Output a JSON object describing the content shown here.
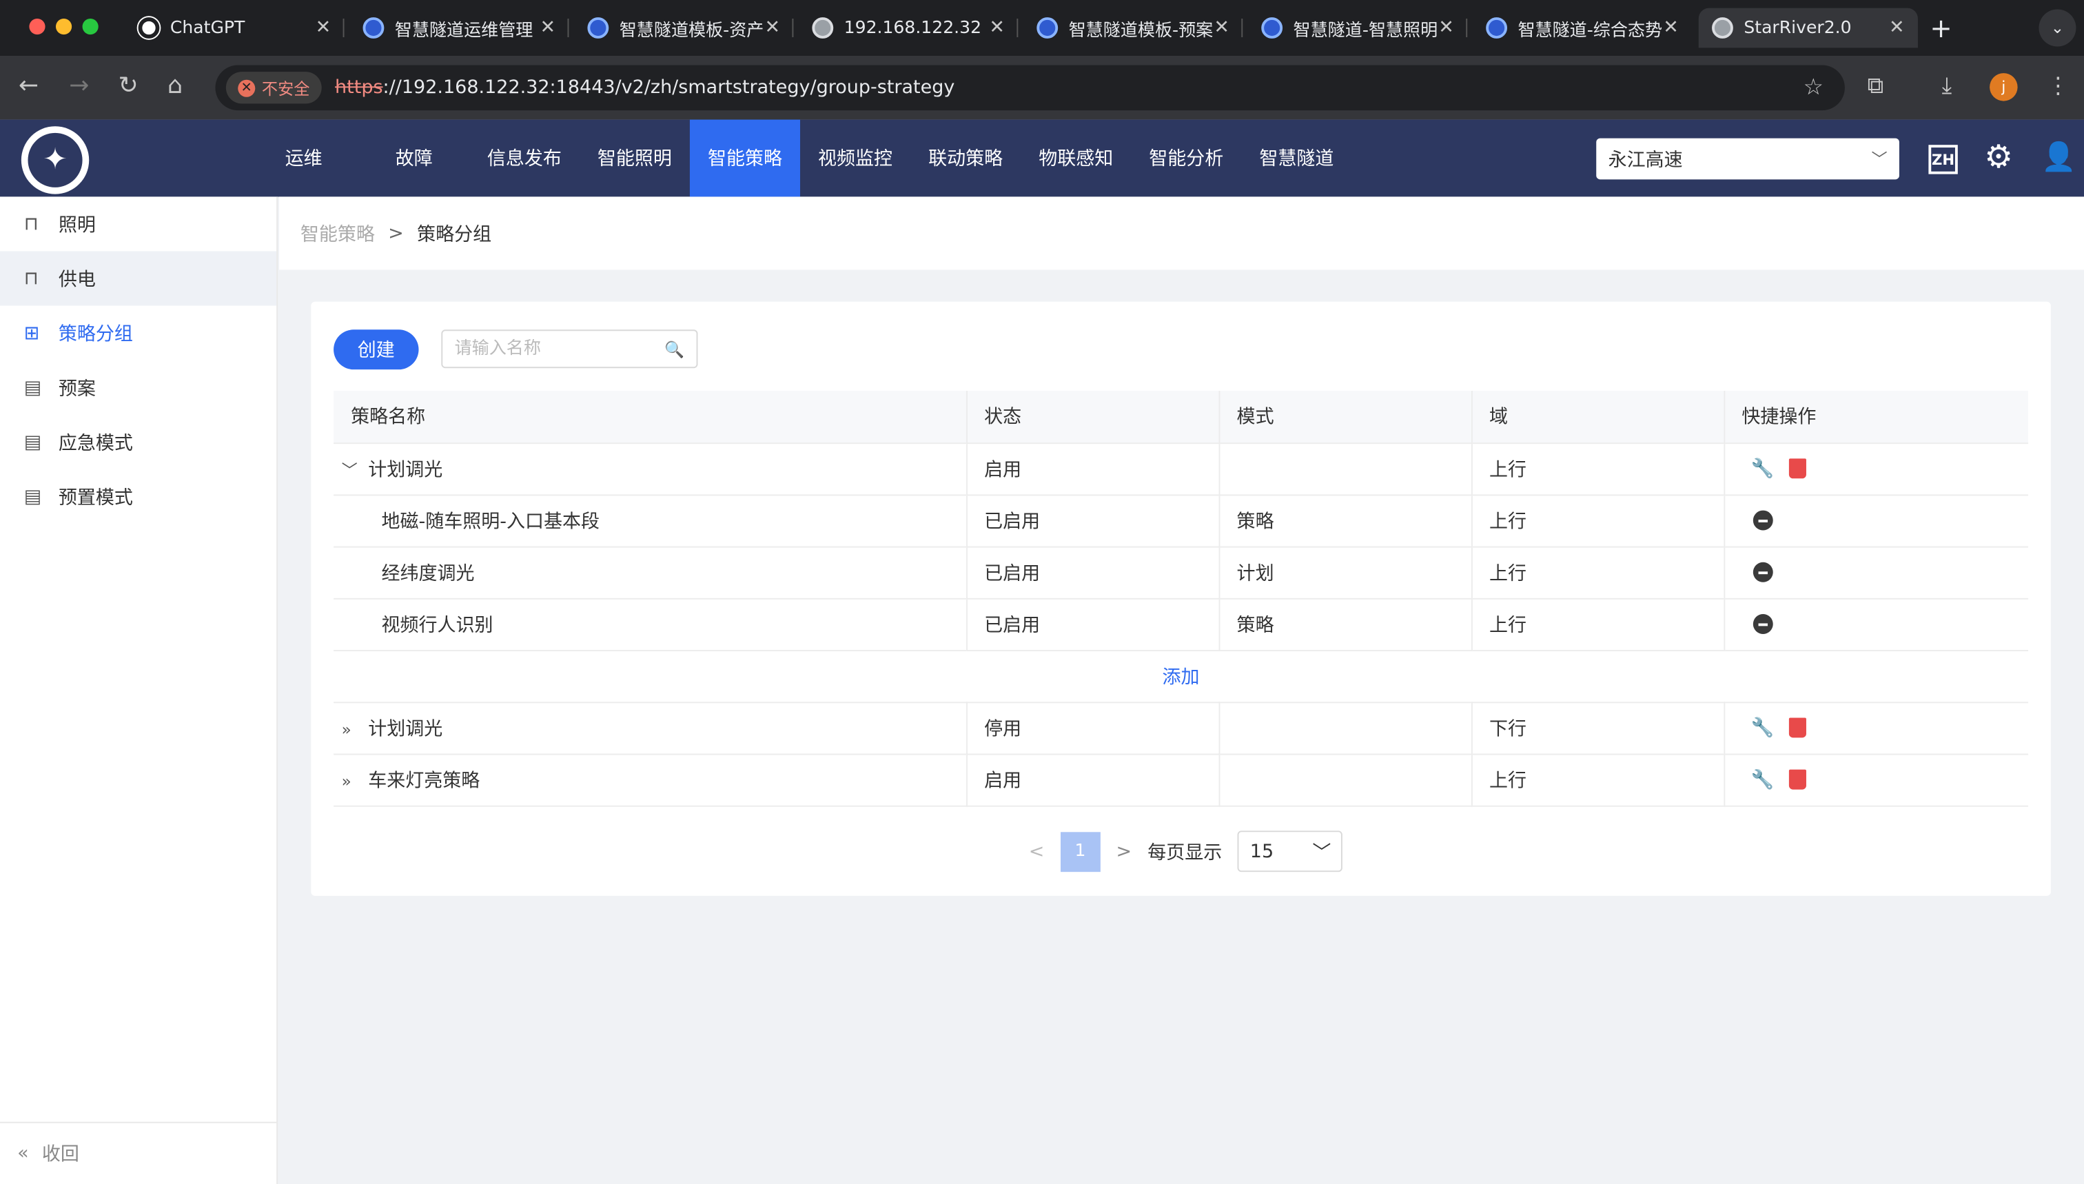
{
  "browser": {
    "tabs": [
      {
        "title": "ChatGPT",
        "icon": "chatgpt-icon"
      },
      {
        "title": "智慧隧道运维管理",
        "icon": "app-icon"
      },
      {
        "title": "智慧隧道模板-资产",
        "icon": "app-icon"
      },
      {
        "title": "192.168.122.32",
        "icon": "globe-icon"
      },
      {
        "title": "智慧隧道模板-预案",
        "icon": "app-icon"
      },
      {
        "title": "智慧隧道-智慧照明",
        "icon": "app-icon"
      },
      {
        "title": "智慧隧道-综合态势",
        "icon": "app-icon"
      },
      {
        "title": "StarRiver2.0",
        "icon": "globe-icon"
      }
    ],
    "close_glyph": "✕",
    "new_tab": "+",
    "security_label": "不安全",
    "url_scheme": "https",
    "url_rest": "://192.168.122.32:18443/v2/zh/smartstrategy/group-strategy",
    "profile_initial": "j"
  },
  "header": {
    "logo_glyph": "✦",
    "menu": [
      "运维",
      "故障",
      "信息发布",
      "智能照明",
      "智能策略",
      "视频监控",
      "联动策略",
      "物联感知",
      "智能分析",
      "智慧隧道"
    ],
    "active_menu": "智能策略",
    "region": "永江高速",
    "lang": "ZH"
  },
  "sidebar": {
    "items": [
      {
        "label": "照明",
        "icon": "router-icon"
      },
      {
        "label": "供电",
        "icon": "router-icon"
      },
      {
        "label": "策略分组",
        "icon": "grid-icon"
      },
      {
        "label": "预案",
        "icon": "calendar-icon"
      },
      {
        "label": "应急模式",
        "icon": "calendar-icon"
      },
      {
        "label": "预置模式",
        "icon": "calendar-icon"
      }
    ],
    "collapse_label": "收回"
  },
  "breadcrumb": {
    "parent": "智能策略",
    "current": "策略分组"
  },
  "toolbar": {
    "create_label": "创建",
    "search_placeholder": "请输入名称"
  },
  "table": {
    "headers": [
      "策略名称",
      "状态",
      "模式",
      "域",
      "快捷操作"
    ],
    "groups": [
      {
        "name": "计划调光",
        "status": "启用",
        "mode": "",
        "domain": "上行",
        "expanded": true,
        "children": [
          {
            "name": "地磁-随车照明-入口基本段",
            "status": "已启用",
            "mode": "策略",
            "domain": "上行"
          },
          {
            "name": "经纬度调光",
            "status": "已启用",
            "mode": "计划",
            "domain": "上行"
          },
          {
            "name": "视频行人识别",
            "status": "已启用",
            "mode": "策略",
            "domain": "上行"
          }
        ],
        "add_label": "添加"
      },
      {
        "name": "计划调光",
        "status": "停用",
        "mode": "",
        "domain": "下行",
        "expanded": false
      },
      {
        "name": "车来灯亮策略",
        "status": "启用",
        "mode": "",
        "domain": "上行",
        "expanded": false
      }
    ]
  },
  "pagination": {
    "current_page": "1",
    "page_size_label": "每页显示",
    "page_size": "15"
  },
  "colors": {
    "primary": "#2f6bf0",
    "header_bg": "#2d3861",
    "danger": "#e84a4a"
  }
}
